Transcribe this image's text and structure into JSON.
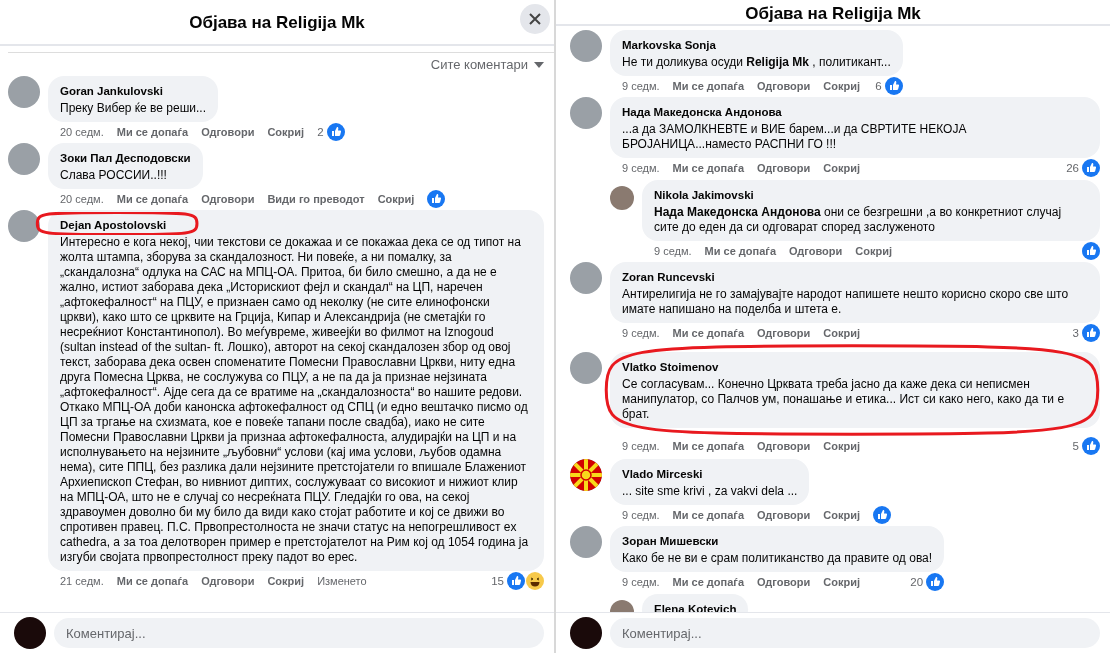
{
  "panels": [
    {
      "title": "Објава на Religija Mk",
      "has_close": true,
      "sort_label": "Сите коментари",
      "comments": [
        {
          "author": "Goran Jankulovski",
          "avatar": {
            "kind": "photo"
          },
          "text": "Преку Вибер ќе ве реши...",
          "time": "20 седм.",
          "actions": [
            "Ми се допаѓа",
            "Одговори",
            "Сокриј"
          ],
          "reaction_count": "2",
          "reactions": [
            {
              "kind": "like"
            }
          ]
        },
        {
          "author": "Зоки Пал Десподовски",
          "avatar": {
            "kind": "photo"
          },
          "text": "Слава РОССИИ..!!!",
          "time": "20 седм.",
          "actions": [
            "Ми се допаѓа",
            "Одговори",
            "Види го преводот",
            "Сокриј"
          ],
          "reactions": [
            {
              "kind": "like"
            }
          ]
        },
        {
          "author": "Dejan Apostolovski",
          "avatar": {
            "kind": "photo"
          },
          "text": "Интересно е кога некој, чии текстови се докажаа и се покажаа дека се од типот на жолта штампа, зборува за скандалозност. Ни повеќе, а ни помалку, за „скандалозна“ одлука на САС на МПЦ-ОА. Притоа, би било смешно, а да не е жално, истиот заборава дека „Историскиот фејл и скандал“ на ЦП, наречен „афтокефалност“ на ПЦУ, е признаен само од неколку (не сите елинофонски цркви), како што се црквите на Грција, Кипар и Александрија (не сметајќи го несреќниот Константинопол). Во меѓувреме, живеејќи во филмот на Iznogoud (sultan instead of the sultan- ft. Лошко), авторот на секој скандалозен збор од овој текст, заборава дека освен споменатите Помесни Православни Цркви, ниту една друга Помесна Црква, не сослужува со ПЦУ, а не па да ја признае нејзината „афтокефалност“. Ајде сега да се вратиме на „скандалозноста“ во нашите редови. Откако МПЦ-ОА доби канонска афтокефалност од СПЦ (и едно вештачко писмо од ЦП за тргање на схизмата, кое е повеќе тапани после свадба), иако не сите Помесни Православни Цркви ја признаа афтокефалноста, алудирајќи на ЦП и на исполнувањето на нејзините „љубовни“ услови (кај има услови, љубов одамна нема), сите ППЦ, без разлика дали нејзините претстојатели го впишале Блажениот Архиепископ Стефан, во нивниот диптих, сослужуваат со високиот и нижиот клир на МПЦ-ОА, што не е случај со несреќната ПЦУ. Гледајќи го ова, на секој здравоумен доволно би му било да види како стојат работите и кој се движи во спротивен правец. П.С. Првопрестолноста не значи статус на непогрешливост ex cathedra, а за тоа делотворен пример е претстојателот на Рим кој од 1054 година ја изгуби својата првопрестолност преку падот во ерес.",
          "time": "21 седм.",
          "actions": [
            "Ми се допаѓа",
            "Одговори",
            "Сокриј"
          ],
          "edited": "Изменето",
          "reaction_count": "15",
          "reactions": [
            {
              "kind": "like"
            },
            {
              "kind": "haha"
            }
          ],
          "circle": {
            "kind": "name"
          }
        }
      ],
      "composer_placeholder": "Коментирај..."
    },
    {
      "title": "Објава на Religija Mk",
      "has_close": false,
      "comments": [
        {
          "author": "Markovska Sonja",
          "avatar": {
            "kind": "photo"
          },
          "text": "Не ти доликува осуди **Religija Mk** , политикант...",
          "time": "9 седм.",
          "actions": [
            "Ми се допаѓа",
            "Одговори",
            "Сокриј"
          ],
          "reaction_count": "6",
          "reactions": [
            {
              "kind": "like"
            }
          ]
        },
        {
          "author": "Нада Македонска Андонова",
          "avatar": {
            "kind": "photo"
          },
          "text": "...а да ЗАМОЛКНЕВТЕ и ВИЕ барем...и да СВРТИТЕ НЕКОЈА БРОЈАНИЦА...наместо РАСПНИ ГО !!!",
          "time": "9 седм.",
          "actions": [
            "Ми се допаѓа",
            "Одговори",
            "Сокриј"
          ],
          "reaction_count": "26",
          "reactions": [
            {
              "kind": "like"
            }
          ],
          "children": [
            {
              "author": "Nikola Jakimovski",
              "avatar": {
                "kind": "photo"
              },
              "text": "**Нада Македонска Андонова** они се безгрешни ,а во конкретниот случај сите до еден да си одговарат според заслуженото",
              "time": "9 седм.",
              "actions": [
                "Ми се допаѓа",
                "Одговори",
                "Сокриј"
              ],
              "reactions": [
                {
                  "kind": "like"
                }
              ]
            }
          ]
        },
        {
          "author": "Zoran Runcevski",
          "avatar": {
            "kind": "photo"
          },
          "text": "Антирелигија не го замајувајте народот напишете нешто корисно скоро све што имате напишано на поделба и штета е.",
          "time": "9 седм.",
          "actions": [
            "Ми се допаѓа",
            "Одговори",
            "Сокриј"
          ],
          "reaction_count": "3",
          "reactions": [
            {
              "kind": "like"
            }
          ]
        },
        {
          "author": "Vlatko Stoimenov",
          "avatar": {
            "kind": "photo"
          },
          "text": "Се согласувам... Конечно Црквата треба јасно да каже дека си неписмен манипулатор, со Палчов ум, понашање и етика... Ист си како него, како да ти е брат.",
          "time": "9 седм.",
          "actions": [
            "Ми се допаѓа",
            "Одговори",
            "Сокриј"
          ],
          "reaction_count": "5",
          "reactions": [
            {
              "kind": "like"
            }
          ],
          "circle": {
            "kind": "comment"
          }
        },
        {
          "author": "Vlado Mirceski",
          "avatar": {
            "kind": "flag"
          },
          "text": "... site sme krivi , za vakvi dela ...",
          "time": "9 седм.",
          "actions": [
            "Ми се допаѓа",
            "Одговори",
            "Сокриј"
          ],
          "reactions": [
            {
              "kind": "like"
            }
          ]
        },
        {
          "author": "Зоран Мишевски",
          "avatar": {
            "kind": "photo"
          },
          "text": "Како бе не ви е срам политиканство да правите од ова!",
          "time": "9 седм.",
          "actions": [
            "Ми се допаѓа",
            "Одговори",
            "Сокриј"
          ],
          "reaction_count": "20",
          "reactions": [
            {
              "kind": "like"
            }
          ],
          "children": [
            {
              "author": "Elena Kotevich",
              "avatar": {
                "kind": "photo"
              }
            }
          ]
        }
      ],
      "composer_placeholder": "Коментирај..."
    }
  ]
}
